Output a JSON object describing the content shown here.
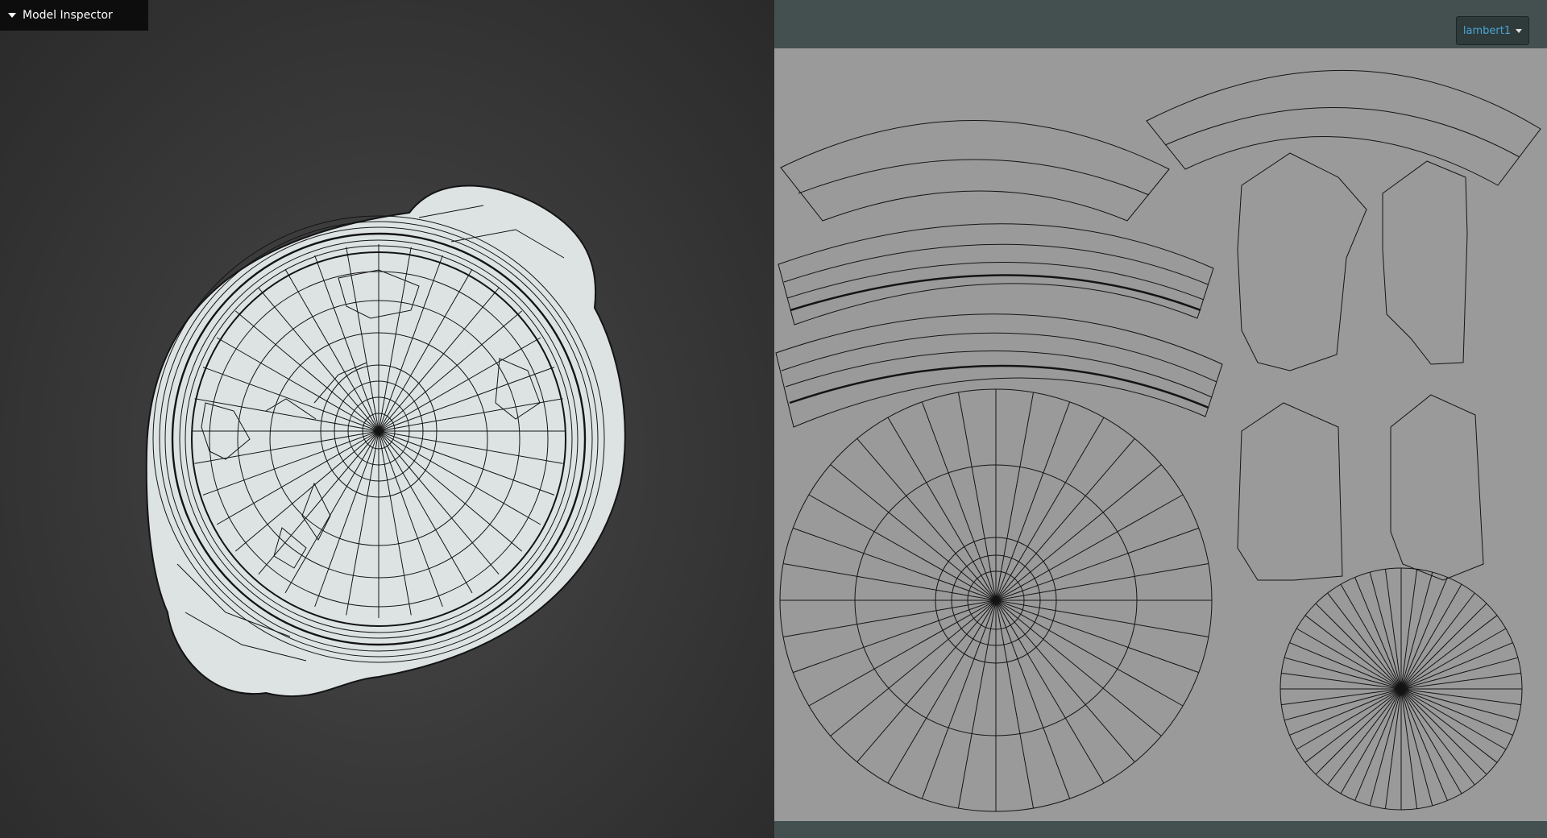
{
  "inspector": {
    "title": "Model Inspector",
    "caret_icon": "caret-down-icon"
  },
  "uv_panel": {
    "material": {
      "selected": "lambert1",
      "dropdown_icon": "chevron-down-icon",
      "text_color": "#4aa3d6"
    }
  },
  "colors": {
    "viewport_bg": "#3a3a3a",
    "mesh_fill": "#dde3e3",
    "wire": "#141414",
    "uv_bg": "#9a9a9a",
    "panel_bg": "#43504f"
  }
}
